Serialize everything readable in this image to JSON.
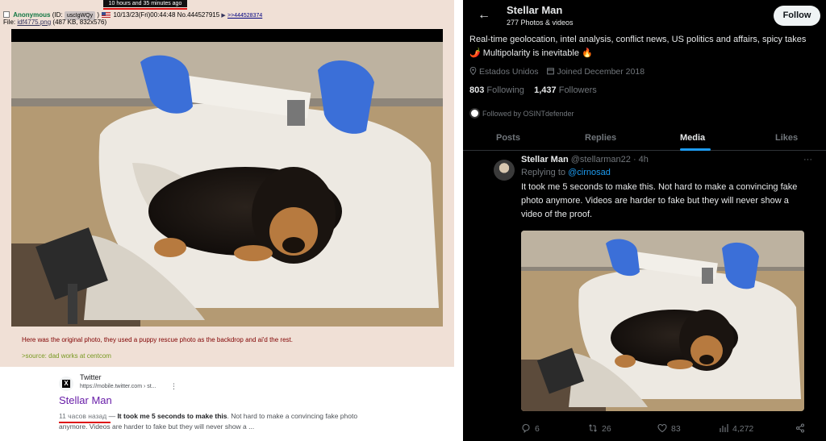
{
  "left_post": {
    "tooltip": "10 hours and 35 minutes ago",
    "poster_name": "Anonymous",
    "id_prefix": "(ID:",
    "poster_id": "uscIgWQy",
    "id_suffix": ")",
    "datetime": "10/13/23(Fri)00:44:48",
    "post_no": "No.444527915",
    "reply_arrow": "▶",
    "backlink": ">>444528374",
    "file_prefix": "File:",
    "file_name": "idf4775.png",
    "file_info": "(487 KB, 832x576)",
    "comment": "Here was the original photo, they used a puppy rescue photo as the backdrop and ai'd the rest.",
    "greentext": ">source: dad works at centcom"
  },
  "google_result": {
    "logo_letter": "X",
    "site_name": "Twitter",
    "url": "https://mobile.twitter.com › st...",
    "menu_glyph": "⋮",
    "title": "Stellar Man",
    "date": "11 часов назад",
    "separator": " — ",
    "snippet_bold": "It took me 5 seconds to make this",
    "snippet_rest": ". Not hard to make a convincing fake photo anymore. Videos are harder to fake but they will never show a ..."
  },
  "profile": {
    "back_glyph": "←",
    "name": "Stellar Man",
    "subtitle": "277 Photos & videos",
    "follow_label": "Follow",
    "bio": "Real-time geolocation, intel analysis, conflict news, US politics and affairs, spicy takes 🌶️  Multipolarity is inevitable 🔥",
    "location": "Estados Unidos",
    "joined": "Joined December 2018",
    "following_count": "803",
    "following_label": "Following",
    "followers_count": "1,437",
    "followers_label": "Followers",
    "followed_by": "Followed by OSINTdefender",
    "tabs": [
      "Posts",
      "Replies",
      "Media",
      "Likes"
    ],
    "active_tab": "Media"
  },
  "tweet": {
    "name": "Stellar Man",
    "handle_time": " @stellarman22 · 4h",
    "more_glyph": "···",
    "replying_prefix": "Replying to ",
    "replying_handle": "@cirnosad",
    "text": "It took me 5 seconds to make this. Not hard to make a convincing fake photo anymore. Videos are harder to fake but they will never show a video of the proof.",
    "replies": "6",
    "reposts": "26",
    "likes": "83",
    "views": "4,272"
  },
  "colors": {
    "board_bg": "#f0e0d6",
    "board_name": "#117743",
    "board_text": "#800000",
    "greentext": "#789922",
    "x_bg": "#000000",
    "x_accent": "#1d9bf0",
    "annotation_red": "#dd1111"
  },
  "icons": {
    "post_checkbox": "checkbox-icon",
    "flag": "us-flag-icon",
    "location": "location-pin-icon",
    "calendar": "calendar-icon",
    "reply": "reply-icon",
    "repost": "repost-icon",
    "like": "heart-icon",
    "views": "views-icon",
    "share": "share-icon"
  }
}
